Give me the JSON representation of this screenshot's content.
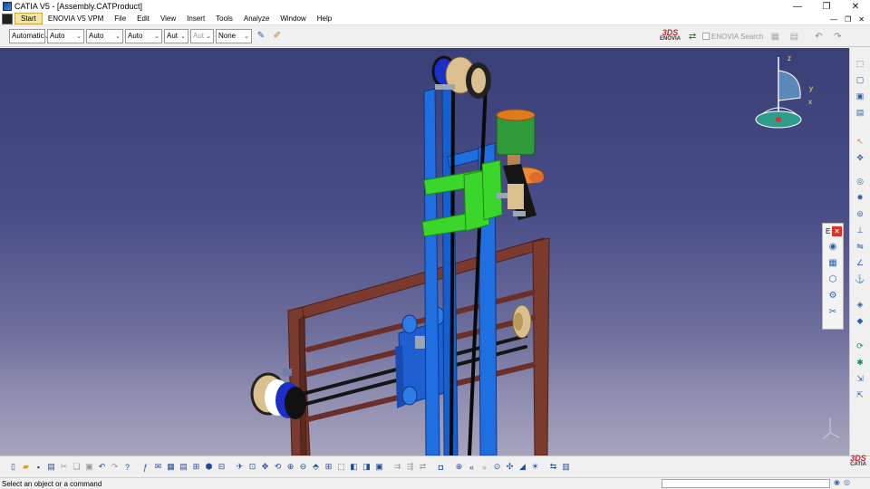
{
  "window": {
    "title": "CATIA V5 - [Assembly.CATProduct]",
    "controls": [
      "—",
      "❐",
      "✕"
    ]
  },
  "menu": {
    "items": [
      "Start",
      "ENOVIA V5 VPM",
      "File",
      "Edit",
      "View",
      "Insert",
      "Tools",
      "Analyze",
      "Window",
      "Help"
    ],
    "doc_controls": [
      "—",
      "❐",
      "✕"
    ]
  },
  "graphic_properties": {
    "color": "Automatic",
    "transparency": "Auto",
    "line_thickness": "Auto",
    "line_type": "Auto",
    "point_type": "Aut",
    "rendering": "Aut",
    "layer": "None"
  },
  "enovia": {
    "logo": "ENOVIA",
    "search_label": "ENOVIA Search"
  },
  "compass": {
    "axis_x": "x",
    "axis_y": "y",
    "axis_z": "z"
  },
  "floating_toolbar": {
    "header_letter": "E",
    "close": "✕"
  },
  "catia_logo": "CATIA",
  "status": {
    "message": "Select an object or a command",
    "command_value": ""
  },
  "colors": {
    "viewport_top": "#3b3f78",
    "viewport_bottom": "#a7a4bd",
    "frame": "#7a3a2e",
    "column": "#1f6fe0",
    "bracket": "#3bd62b",
    "cup": "#2f9a3a",
    "lid": "#e07a1e"
  }
}
